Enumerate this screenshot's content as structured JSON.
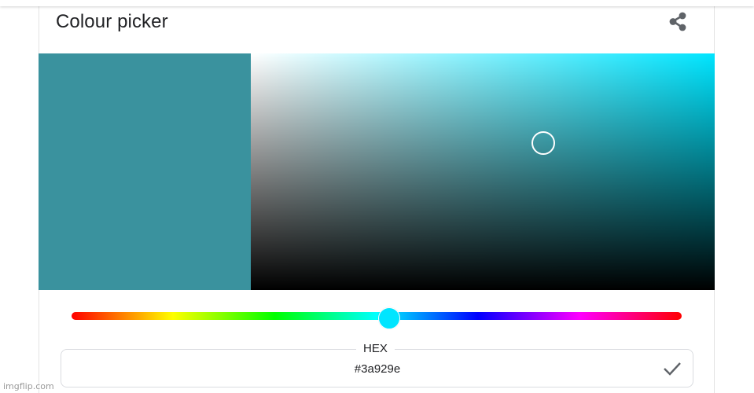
{
  "header": {
    "title": "Colour picker",
    "share_icon": "share-icon"
  },
  "picker": {
    "selected_color": "#3a929e",
    "hue_color": "#00e5ff",
    "saturation": 0.63,
    "value": 0.62,
    "hue_position": 0.52
  },
  "hex": {
    "label": "HEX",
    "value": "#3a929e",
    "confirm_icon": "check-icon"
  },
  "watermark": {
    "text": "imgflip.com"
  }
}
